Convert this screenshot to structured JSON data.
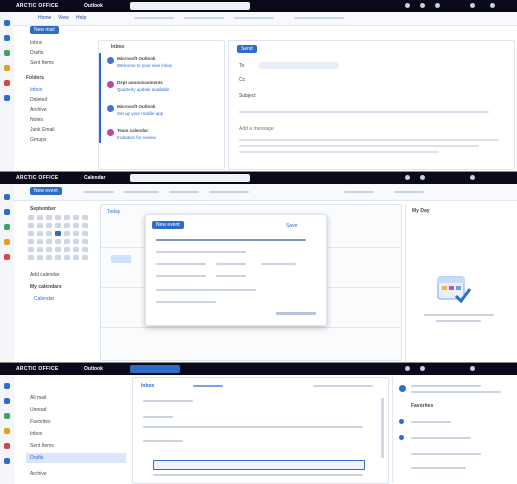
{
  "pane1": {
    "brand": "ARCTIC OFFICE",
    "app": "Outlook",
    "new_mail": "New mail",
    "tabs": [
      "Home",
      "View",
      "Help"
    ],
    "folders": [
      "Inbox",
      "Drafts",
      "Sent Items",
      "Folders",
      "Inbox",
      "Deleted",
      "Archive",
      "Notes",
      "Junk Email",
      "Groups"
    ],
    "mail_header": "Inbox",
    "mails": [
      {
        "from": "Microsoft Outlook",
        "subject": "Welcome to your new inbox",
        "color": "#4b6fd8"
      },
      {
        "from": "Dept announcements",
        "subject": "Quarterly update available",
        "color": "#b84aa6"
      },
      {
        "from": "Microsoft Outlook",
        "subject": "Set up your mobile app",
        "color": "#4b6fd8"
      },
      {
        "from": "Team calendar",
        "subject": "Invitation for review",
        "color": "#b84aa6"
      }
    ],
    "compose_send": "Send",
    "compose_to": "To",
    "compose_cc": "Cc",
    "compose_subject": "Subject",
    "compose_body": "Add a message"
  },
  "pane2": {
    "brand": "ARCTIC OFFICE",
    "app": "Calendar",
    "new_event": "New event",
    "today": "Today",
    "month": "September",
    "add_calendar": "Add calendar",
    "my_calendars": "My calendars",
    "calendar": "Calendar",
    "dialog_title": "New event",
    "dialog_save": "Save",
    "panel_title": "My Day"
  },
  "pane3": {
    "brand": "ARCTIC OFFICE",
    "app": "Outlook",
    "nav": [
      "All mail",
      "Unread",
      "Favorites",
      "Inbox",
      "Sent Items",
      "Drafts",
      "Archive"
    ],
    "reading_title": "Inbox",
    "folder_header": "Favorites"
  }
}
